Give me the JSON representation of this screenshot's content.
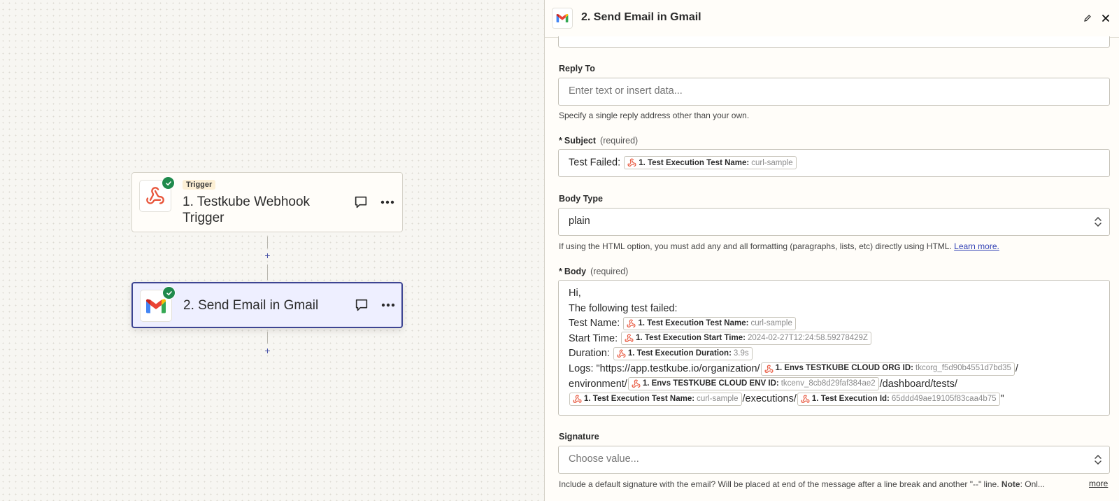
{
  "canvas": {
    "step1": {
      "chip": "Trigger",
      "title": "1. Testkube Webhook Trigger"
    },
    "step2": {
      "title": "2. Send Email in Gmail"
    },
    "add_step": "+"
  },
  "panel": {
    "title": "2. Send Email in Gmail",
    "reply_to": {
      "label": "Reply To",
      "placeholder": "Enter text or insert data...",
      "help": "Specify a single reply address other than your own."
    },
    "subject": {
      "star": "*",
      "label": "Subject",
      "required": "(required)",
      "prefix": "Test Failed:",
      "pill": {
        "label": "1. Test Execution Test Name:",
        "value": "curl-sample"
      }
    },
    "body_type": {
      "label": "Body Type",
      "value": "plain",
      "help": "If using the HTML option, you must add any and all formatting (paragraphs, lists, etc) directly using HTML.",
      "link": "Learn more."
    },
    "body": {
      "star": "*",
      "label": "Body",
      "required": "(required)",
      "line1": "Hi,",
      "line2": "The following test failed:",
      "test_name_prefix": "Test Name:",
      "test_name_pill": {
        "label": "1. Test Execution Test Name:",
        "value": "curl-sample"
      },
      "start_time_prefix": "Start Time:",
      "start_time_pill": {
        "label": "1. Test Execution Start Time:",
        "value": "2024-02-27T12:24:58.59278429Z"
      },
      "duration_prefix": "Duration:",
      "duration_pill": {
        "label": "1. Test Execution Duration:",
        "value": "3.9s"
      },
      "logs_prefix": "Logs: \"https://app.testkube.io/organization/",
      "org_pill": {
        "label": "1. Envs TESTKUBE CLOUD ORG ID:",
        "value": "tkcorg_f5d90b4551d7bd35"
      },
      "slash": "/",
      "env_prefix": "environment/",
      "env_pill": {
        "label": "1. Envs TESTKUBE CLOUD ENV ID:",
        "value": "tkcenv_8cb8d29faf384ae2"
      },
      "dashboard_path": "/dashboard/tests/",
      "test_name_pill2": {
        "label": "1. Test Execution Test Name:",
        "value": "curl-sample"
      },
      "executions_path": "/executions/",
      "id_pill": {
        "label": "1. Test Execution Id:",
        "value": "65ddd49ae19105f83caa4b75"
      },
      "closing_quote": "\""
    },
    "signature": {
      "label": "Signature",
      "placeholder": "Choose value...",
      "help_start": "Include a default signature with the email? Will be placed at end of the message after a line break and another \"--\" line.",
      "help_bold": "Note",
      "help_end": ": Onl...",
      "more": "more"
    }
  },
  "colors": {
    "accent": "#3d4592",
    "webhook": "#e8553b",
    "success": "#1f8a4c"
  }
}
